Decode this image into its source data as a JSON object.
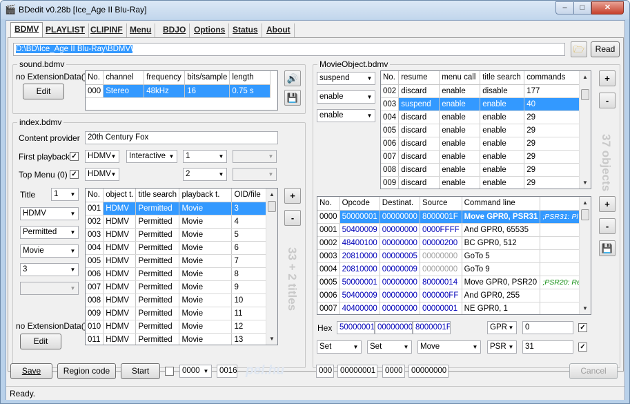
{
  "window": {
    "title": "BDedit v0.28b [Ice_Age II Blu-Ray]",
    "min": "–",
    "max": "□",
    "close": "✕"
  },
  "tabs": [
    "BDMV",
    "PLAYLIST",
    "CLIPINF",
    "Menu",
    "BDJO",
    "Options",
    "Status",
    "About"
  ],
  "path": {
    "value": "D:\\BD\\Ice_Age II Blu-Ray\\BDMV\\",
    "read_label": "Read",
    "folder_icon": "folder-open-icon"
  },
  "sound": {
    "title": "sound.bdmv",
    "ext_label": "no ExtensionData()",
    "edit_label": "Edit",
    "columns": [
      "No.",
      "channel",
      "frequency",
      "bits/sample",
      "length"
    ],
    "rows": [
      [
        "000",
        "Stereo",
        "48kHz",
        "16",
        "0.75 s"
      ]
    ]
  },
  "index": {
    "title": "index.bdmv",
    "content_provider_label": "Content provider",
    "content_provider_value": "20th Century Fox",
    "first_playback_label": "First playback",
    "first_playback_type": "HDMV",
    "first_playback_mode": "Interactive",
    "first_playback_obj": "1",
    "top_menu_label": "Top Menu (0)",
    "top_menu_type": "HDMV",
    "top_menu_obj": "2",
    "title_label": "Title",
    "title_value": "1",
    "side_type": "HDMV",
    "side_search": "Permitted",
    "side_playback": "Movie",
    "side_oid": "3",
    "ext_label": "no ExtensionData()",
    "edit_label": "Edit",
    "columns": [
      "No.",
      "object t.",
      "title search",
      "playback t.",
      "OID/file"
    ],
    "rows": [
      [
        "001",
        "HDMV",
        "Permitted",
        "Movie",
        "3"
      ],
      [
        "002",
        "HDMV",
        "Permitted",
        "Movie",
        "4"
      ],
      [
        "003",
        "HDMV",
        "Permitted",
        "Movie",
        "5"
      ],
      [
        "004",
        "HDMV",
        "Permitted",
        "Movie",
        "6"
      ],
      [
        "005",
        "HDMV",
        "Permitted",
        "Movie",
        "7"
      ],
      [
        "006",
        "HDMV",
        "Permitted",
        "Movie",
        "8"
      ],
      [
        "007",
        "HDMV",
        "Permitted",
        "Movie",
        "9"
      ],
      [
        "008",
        "HDMV",
        "Permitted",
        "Movie",
        "10"
      ],
      [
        "009",
        "HDMV",
        "Permitted",
        "Movie",
        "11"
      ],
      [
        "010",
        "HDMV",
        "Permitted",
        "Movie",
        "12"
      ],
      [
        "011",
        "HDMV",
        "Permitted",
        "Movie",
        "13"
      ]
    ],
    "count_text": "33 + 2 titles",
    "plus": "+",
    "minus": "-"
  },
  "movie": {
    "title": "MovieObject.bdmv",
    "combo1": "suspend",
    "combo2": "enable",
    "combo3": "enable",
    "columns": [
      "No.",
      "resume",
      "menu call",
      "title search",
      "commands"
    ],
    "rows": [
      [
        "002",
        "discard",
        "enable",
        "disable",
        "177"
      ],
      [
        "003",
        "suspend",
        "enable",
        "enable",
        "40"
      ],
      [
        "004",
        "discard",
        "enable",
        "enable",
        "29"
      ],
      [
        "005",
        "discard",
        "enable",
        "enable",
        "29"
      ],
      [
        "006",
        "discard",
        "enable",
        "enable",
        "29"
      ],
      [
        "007",
        "discard",
        "enable",
        "enable",
        "29"
      ],
      [
        "008",
        "discard",
        "enable",
        "enable",
        "29"
      ],
      [
        "009",
        "discard",
        "enable",
        "enable",
        "29"
      ]
    ],
    "count_text": "37 objects",
    "plus": "+",
    "minus": "-",
    "cmd_columns": [
      "No.",
      "Opcode",
      "Destinat.",
      "Source",
      "Command line"
    ],
    "cmd_rows": [
      [
        "0000",
        "50000001",
        "00000000",
        "8000001F",
        "Move GPR0, PSR31",
        ";PSR31: Pl"
      ],
      [
        "0001",
        "50400009",
        "00000000",
        "0000FFFF",
        "And GPR0, 65535",
        ""
      ],
      [
        "0002",
        "48400100",
        "00000000",
        "00000200",
        "BC GPR0, 512",
        ""
      ],
      [
        "0003",
        "20810000",
        "00000005",
        "00000000",
        "GoTo 5",
        ""
      ],
      [
        "0004",
        "20810000",
        "00000009",
        "00000000",
        "GoTo 9",
        ""
      ],
      [
        "0005",
        "50000001",
        "00000000",
        "80000014",
        "Move GPR0, PSR20",
        ";PSR20: Regi"
      ],
      [
        "0006",
        "50400009",
        "00000000",
        "000000FF",
        "And GPR0, 255",
        ""
      ],
      [
        "0007",
        "40400000",
        "00000000",
        "00000001",
        "NE GPR0, 1",
        ""
      ]
    ],
    "hex_label": "Hex",
    "hex1": "50000001",
    "hex2": "00000000",
    "hex3": "8000001F",
    "reg1_type": "GPR",
    "reg1_value": "0",
    "set1": "Set",
    "set2": "Set",
    "op": "Move",
    "reg2_type": "PSR",
    "reg2_value": "31"
  },
  "bottom": {
    "save": "Save",
    "region": "Region code",
    "start": "Start",
    "combo": "0000",
    "field1": "0016",
    "field2": "000",
    "field3": "00000001",
    "field4": "0000",
    "field5": "00000000",
    "cancel": "Cancel",
    "watermark": "pel.hu"
  },
  "status": "Ready."
}
